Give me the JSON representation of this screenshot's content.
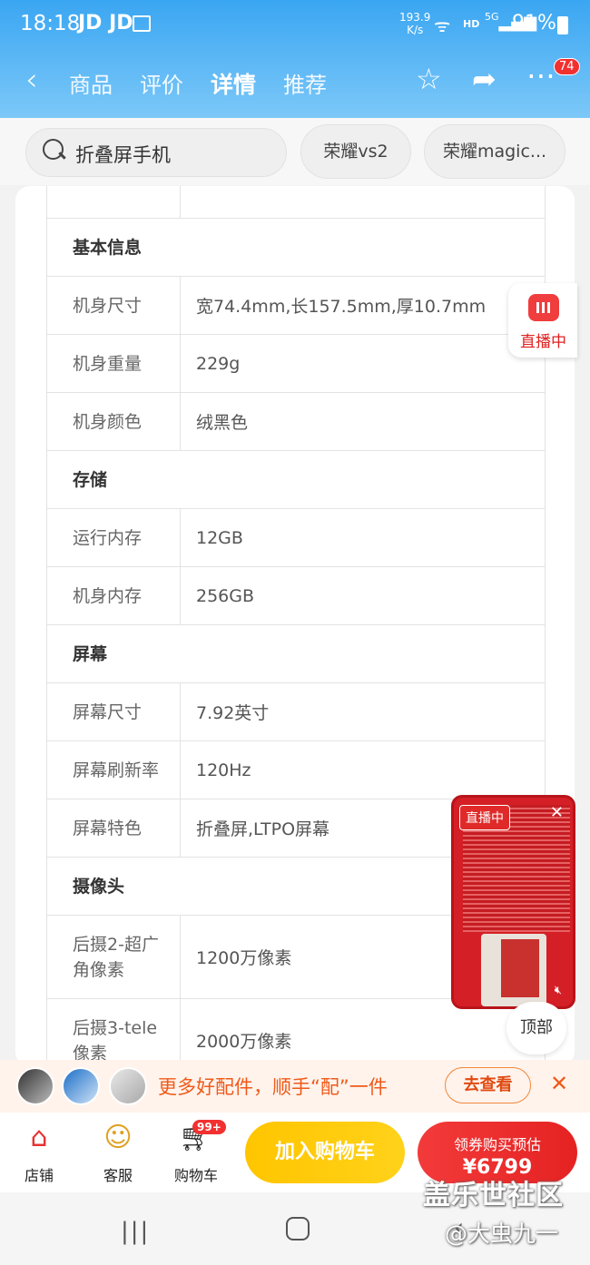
{
  "status_bar": {
    "time": "18:18",
    "apps": "JD JD",
    "speed": "193.9",
    "speed_unit": "K/s",
    "hd": "HD",
    "signal": "5G",
    "battery": "91%"
  },
  "nav": {
    "tabs": [
      "商品",
      "评价",
      "详情",
      "推荐"
    ],
    "active_tab": "详情",
    "message_badge": "74"
  },
  "search": {
    "placeholder": "折叠屏手机",
    "chips": [
      "荣耀vs2",
      "荣耀magic..."
    ]
  },
  "specs": [
    {
      "type": "section",
      "label": "基本信息"
    },
    {
      "type": "row",
      "key": "机身尺寸",
      "value": "宽74.4mm,长157.5mm,厚10.7mm"
    },
    {
      "type": "row",
      "key": "机身重量",
      "value": "229g"
    },
    {
      "type": "row",
      "key": "机身颜色",
      "value": "绒黑色"
    },
    {
      "type": "section",
      "label": "存储"
    },
    {
      "type": "row",
      "key": "运行内存",
      "value": "12GB"
    },
    {
      "type": "row",
      "key": "机身内存",
      "value": "256GB"
    },
    {
      "type": "section",
      "label": "屏幕"
    },
    {
      "type": "row",
      "key": "屏幕尺寸",
      "value": "7.92英寸"
    },
    {
      "type": "row",
      "key": "屏幕刷新率",
      "value": "120Hz"
    },
    {
      "type": "row",
      "key": "屏幕特色",
      "value": "折叠屏,LTPO屏幕"
    },
    {
      "type": "section",
      "label": "摄像头"
    },
    {
      "type": "row",
      "key": "后摄2-超广角像素",
      "value": "1200万像素",
      "tall": true
    },
    {
      "type": "row",
      "key": "后摄3-tele像素",
      "value": "2000万像素",
      "tall": true
    }
  ],
  "live": {
    "side_label": "直播中",
    "window_tag": "直播中"
  },
  "top_button": "顶部",
  "promo": {
    "text": "更多好配件，顺手“配”一件",
    "button": "去查看"
  },
  "bottom_bar": {
    "store": "店铺",
    "service": "客服",
    "cart": "购物车",
    "cart_badge": "99+",
    "add_to_cart": "加入购物车",
    "buy_title": "领券购买预估",
    "buy_price": "¥6799"
  },
  "watermark": {
    "line1": "盖乐世社区",
    "line2": "@大虫九一"
  },
  "colors": {
    "header_blue": "#3aa6f2",
    "accent_red": "#f23030",
    "cart_yellow": "#ffc500",
    "promo_orange": "#ef5a1a"
  }
}
